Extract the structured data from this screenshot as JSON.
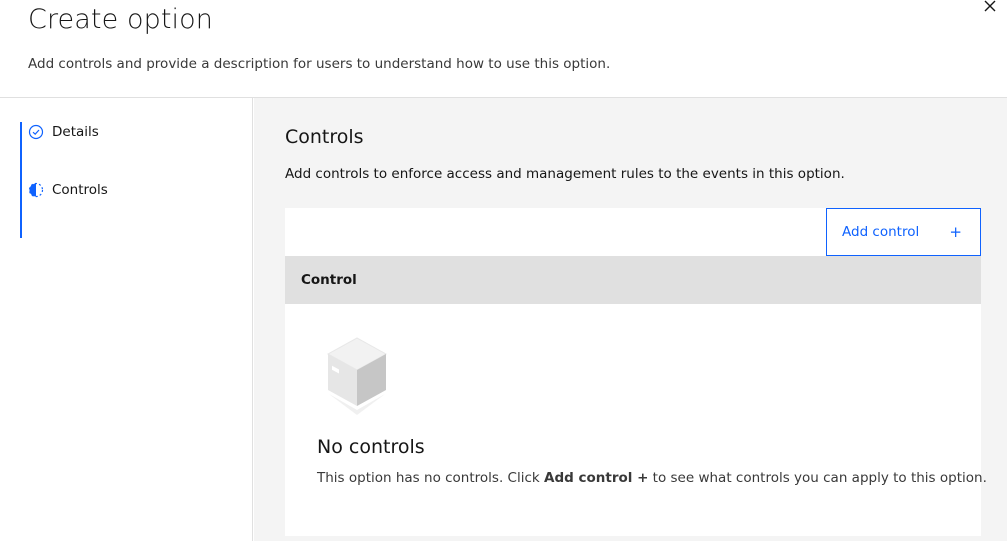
{
  "header": {
    "title": "Create option",
    "subtitle": "Add controls and provide a description for users to understand how to use this option.",
    "close_icon": "close-icon"
  },
  "steps": [
    {
      "label": "Details",
      "status": "complete",
      "icon": "checkmark-circle-icon"
    },
    {
      "label": "Controls",
      "status": "current",
      "icon": "half-circle-icon"
    }
  ],
  "main": {
    "title": "Controls",
    "description": "Add controls to enforce access and management rules to the events in this option.",
    "add_button_label": "Add control",
    "add_button_icon": "+",
    "table_header": "Control",
    "empty_state": {
      "title": "No controls",
      "text_before": "This option has no controls. Click ",
      "text_bold": "Add control +",
      "text_after": " to see what controls you can apply to this option.",
      "illustration": "empty-box-icon"
    }
  },
  "colors": {
    "accent": "#0f62fe",
    "panel_bg": "#f4f4f4",
    "table_header_bg": "#e0e0e0"
  }
}
